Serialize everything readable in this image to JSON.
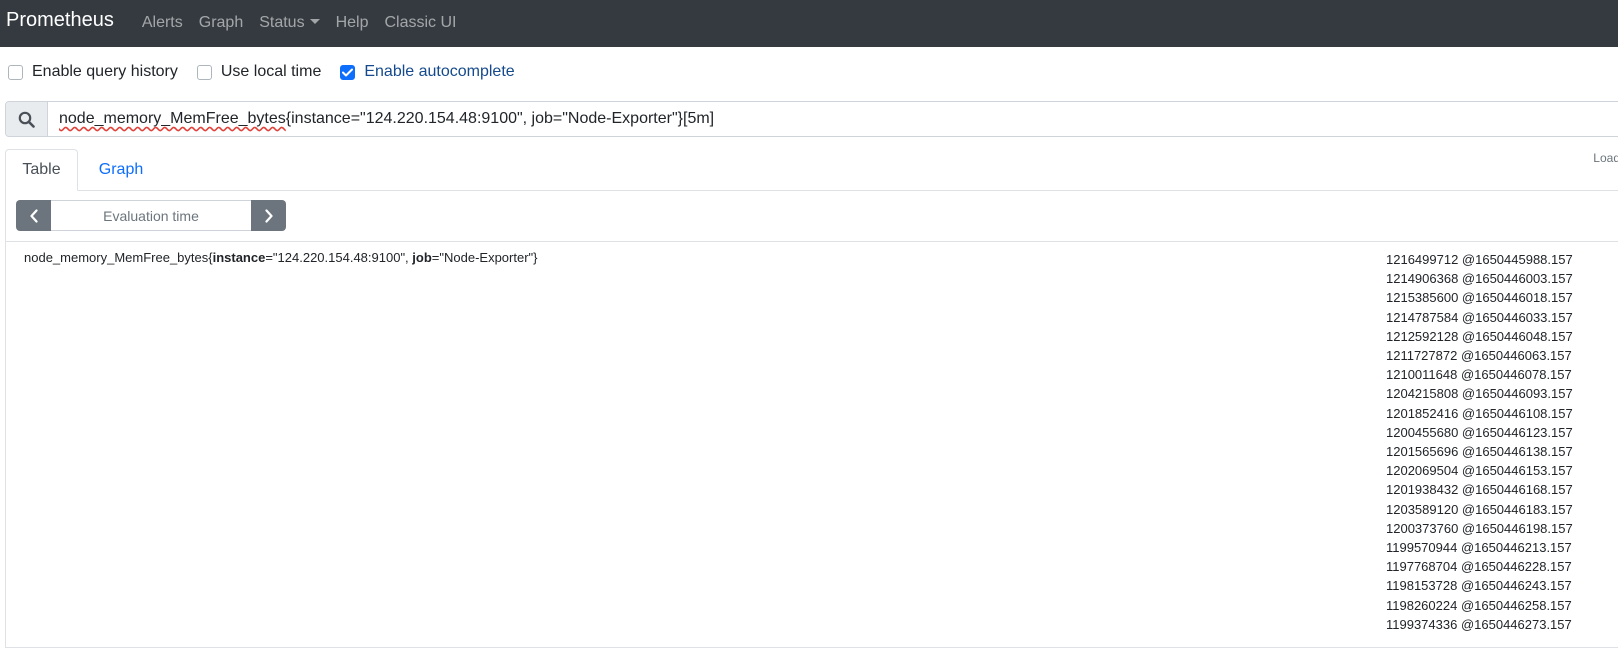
{
  "navbar": {
    "brand": "Prometheus",
    "links": [
      "Alerts",
      "Graph",
      "Status",
      "Help",
      "Classic UI"
    ]
  },
  "options": [
    {
      "label": "Enable query history",
      "checked": false
    },
    {
      "label": "Use local time",
      "checked": false
    },
    {
      "label": "Enable autocomplete",
      "checked": true
    }
  ],
  "query": {
    "metric": "node_memory_MemFree_bytes",
    "rest": "{instance=\"124.220.154.48:9100\", job=\"Node-Exporter\"}[5m]"
  },
  "load_hint": "Load",
  "tabs": [
    "Table",
    "Graph"
  ],
  "evaluation": {
    "placeholder": "Evaluation time"
  },
  "result": {
    "metric": "node_memory_MemFree_bytes",
    "open": "{",
    "label1_name": "instance",
    "label1_value": "=\"124.220.154.48:9100\", ",
    "label2_name": "job",
    "label2_value": "=\"Node-Exporter\"",
    "close": "}",
    "values": [
      "1216499712 @1650445988.157",
      "1214906368 @1650446003.157",
      "1215385600 @1650446018.157",
      "1214787584 @1650446033.157",
      "1212592128 @1650446048.157",
      "1211727872 @1650446063.157",
      "1210011648 @1650446078.157",
      "1204215808 @1650446093.157",
      "1201852416 @1650446108.157",
      "1200455680 @1650446123.157",
      "1201565696 @1650446138.157",
      "1202069504 @1650446153.157",
      "1201938432 @1650446168.157",
      "1203589120 @1650446183.157",
      "1200373760 @1650446198.157",
      "1199570944 @1650446213.157",
      "1197768704 @1650446228.157",
      "1198153728 @1650446243.157",
      "1198260224 @1650446258.157",
      "1199374336 @1650446273.157"
    ]
  },
  "colors": {
    "navbar": "#343a40",
    "accent": "#0d6efd",
    "button": "#6c757d"
  }
}
